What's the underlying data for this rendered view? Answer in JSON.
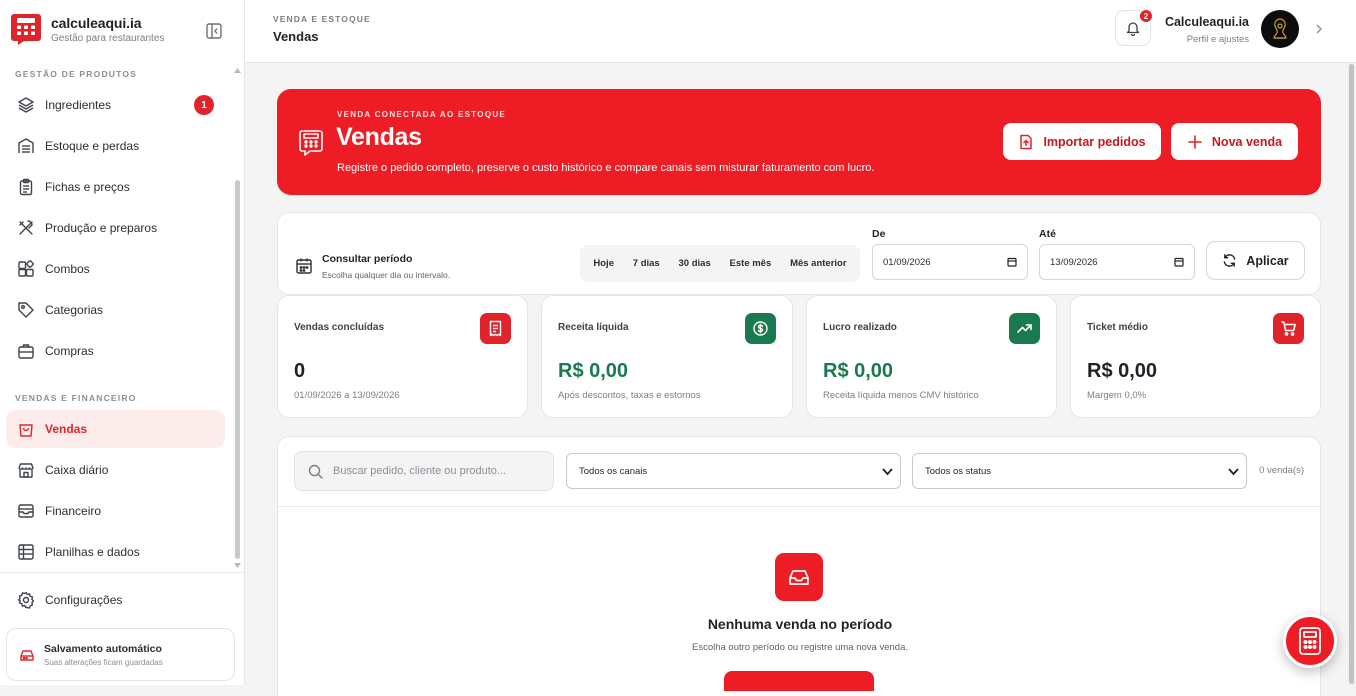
{
  "brand": {
    "name": "calculeaqui.ia",
    "tagline": "Gestão para restaurantes"
  },
  "sidebar": {
    "section_products": "GESTÃO DE PRODUTOS",
    "section_sales": "VENDAS E FINANCEIRO",
    "items": [
      {
        "label": "Ingredientes",
        "icon": "layers-icon",
        "badge": "1"
      },
      {
        "label": "Estoque e perdas",
        "icon": "warehouse-icon"
      },
      {
        "label": "Fichas e preços",
        "icon": "clipboard-icon"
      },
      {
        "label": "Produção e preparos",
        "icon": "utensils-icon"
      },
      {
        "label": "Combos",
        "icon": "blocks-icon"
      },
      {
        "label": "Categorias",
        "icon": "tag-icon"
      },
      {
        "label": "Compras",
        "icon": "briefcase-icon"
      },
      {
        "label": "Vendas",
        "icon": "shopping-bag-icon",
        "active": true
      },
      {
        "label": "Caixa diário",
        "icon": "store-icon"
      },
      {
        "label": "Financeiro",
        "icon": "wallet-icon"
      },
      {
        "label": "Planilhas e dados",
        "icon": "sheet-icon"
      }
    ],
    "settings": "Configurações",
    "autosave": {
      "title": "Salvamento automático",
      "subtitle": "Suas alterações ficam guardadas"
    }
  },
  "header": {
    "breadcrumb": "VENDA E ESTOQUE",
    "title": "Vendas",
    "notifications": "2",
    "user_name": "Calculeaqui.ia",
    "user_sub": "Perfil e ajustes"
  },
  "hero": {
    "eyebrow": "VENDA CONECTADA AO ESTOQUE",
    "title": "Vendas",
    "description": "Registre o pedido completo, preserve o custo histórico e compare canais sem misturar faturamento com lucro.",
    "import_label": "Importar pedidos",
    "new_label": "Nova venda"
  },
  "period": {
    "title": "Consultar período",
    "subtitle": "Escolha qualquer dia ou intervalo.",
    "presets": [
      "Hoje",
      "7 dias",
      "30 dias",
      "Este mês",
      "Mês anterior"
    ],
    "from_label": "De",
    "from_value": "01/09/2026",
    "to_label": "Até",
    "to_value": "13/09/2026",
    "apply_label": "Aplicar"
  },
  "kpis": [
    {
      "label": "Vendas concluídas",
      "value": "0",
      "sub": "01/09/2026 a 13/09/2026",
      "color": "#1f2328",
      "icon_bg": "#e0242b",
      "icon": "receipt-icon"
    },
    {
      "label": "Receita líquida",
      "value": "R$ 0,00",
      "sub": "Após descontos, taxas e estornos",
      "color": "#1a7a4f",
      "icon_bg": "#1a7a4f",
      "icon": "dollar-circle-icon"
    },
    {
      "label": "Lucro realizado",
      "value": "R$ 0,00",
      "sub": "Receita líquida menos CMV histórico",
      "color": "#1a7a4f",
      "icon_bg": "#1a7a4f",
      "icon": "trending-up-icon"
    },
    {
      "label": "Ticket médio",
      "value": "R$ 0,00",
      "sub": "Margem 0,0%",
      "color": "#1f2328",
      "icon_bg": "#e0242b",
      "icon": "cart-icon"
    }
  ],
  "filters": {
    "search_placeholder": "Buscar pedido, cliente ou produto...",
    "channel": "Todos os canais",
    "status": "Todos os status",
    "count": "0 venda(s)"
  },
  "empty": {
    "title": "Nenhuma venda no período",
    "subtitle": "Escolha outro período ou registre uma nova venda."
  },
  "colors": {
    "accent": "#ee1c24",
    "success": "#1a7a4f"
  }
}
